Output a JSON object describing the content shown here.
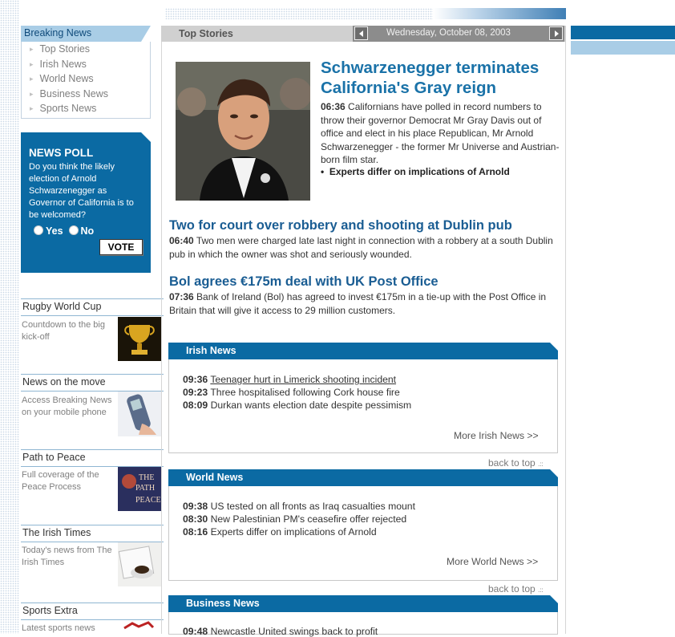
{
  "breaking_news": {
    "title": "Breaking News",
    "items": [
      "Top Stories",
      "Irish News",
      "World News",
      "Business News",
      "Sports News"
    ]
  },
  "poll": {
    "title": "NEWS POLL",
    "question": "Do you think the likely election of Arnold Schwarzenegger as Governor of California is to be welcomed?",
    "option_yes": "Yes",
    "option_no": "No",
    "vote_label": "VOTE"
  },
  "promos": [
    {
      "title": "Rugby World Cup",
      "text": "Countdown to the big kick-off",
      "icon": "trophy-icon"
    },
    {
      "title": "News on the move",
      "text": "Access Breaking News on your mobile phone",
      "icon": "mobile-phone-icon"
    },
    {
      "title": "Path to Peace",
      "text": "Full coverage of the Peace Process",
      "icon": "path-to-peace-image"
    },
    {
      "title": "The Irish Times",
      "text": "Today's news from The Irish Times",
      "icon": "coffee-newspaper-icon"
    },
    {
      "title": "Sports Extra",
      "text": "Latest sports news",
      "icon": "sports-icon"
    }
  ],
  "promo_image_text": {
    "path_line1": "THE",
    "path_line2": "PATH",
    "path_line3": "PEACE"
  },
  "top_stories": {
    "label": "Top Stories",
    "date": "Wednesday, October 08, 2003"
  },
  "lead_story": {
    "headline": "Schwarzenegger terminates California's Gray reign",
    "time": "06:36",
    "body": "Californians have polled in record numbers to throw their governor Democrat Mr Gray Davis out of office and elect in his place Republican, Mr Arnold Schwarzenegger - the former Mr Universe and Austrian-born film star.",
    "related": "Experts differ on implications of Arnold"
  },
  "stories": [
    {
      "headline": "Two for court over robbery and shooting at Dublin pub",
      "time": "06:40",
      "body": "Two men were charged late last night in connection with a robbery at a south Dublin pub in which the owner was shot and seriously wounded."
    },
    {
      "headline": "Bol agrees €175m deal with UK Post Office",
      "time": "07:36",
      "body": "Bank of Ireland (Bol) has agreed to invest €175m in a tie-up with the Post Office in Britain that will give it access to 29 million customers."
    }
  ],
  "sections": [
    {
      "title": "Irish News",
      "items": [
        {
          "time": "09:36",
          "text": "Teenager hurt in Limerick shooting incident"
        },
        {
          "time": "09:23",
          "text": "Three hospitalised following Cork house fire"
        },
        {
          "time": "08:09",
          "text": "Durkan wants election date despite pessimism"
        }
      ],
      "more": "More Irish News  >>"
    },
    {
      "title": "World News",
      "items": [
        {
          "time": "09:38",
          "text": "US tested on all fronts as Iraq casualties mount"
        },
        {
          "time": "08:30",
          "text": "New Palestinian PM's ceasefire offer rejected"
        },
        {
          "time": "08:16",
          "text": "Experts differ on implications of Arnold"
        }
      ],
      "more": "More World News  >>"
    },
    {
      "title": "Business News",
      "items": [
        {
          "time": "09:48",
          "text": "Newcastle United swings back to profit"
        }
      ]
    }
  ],
  "back_to_top": "back to top"
}
